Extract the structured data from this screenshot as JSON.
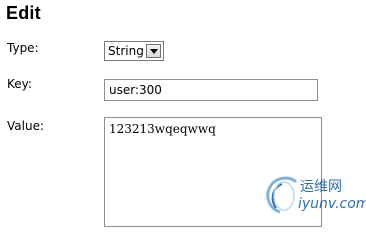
{
  "page": {
    "title": "Edit"
  },
  "form": {
    "type_label": "Type:",
    "type_value": "String",
    "key_label": "Key:",
    "key_value": "user:300",
    "value_label": "Value:",
    "value_value": "123213wqeqwwq"
  },
  "watermark": {
    "line1": "运维网",
    "line2": "iyunv.com",
    "color": "#2d6fae"
  }
}
